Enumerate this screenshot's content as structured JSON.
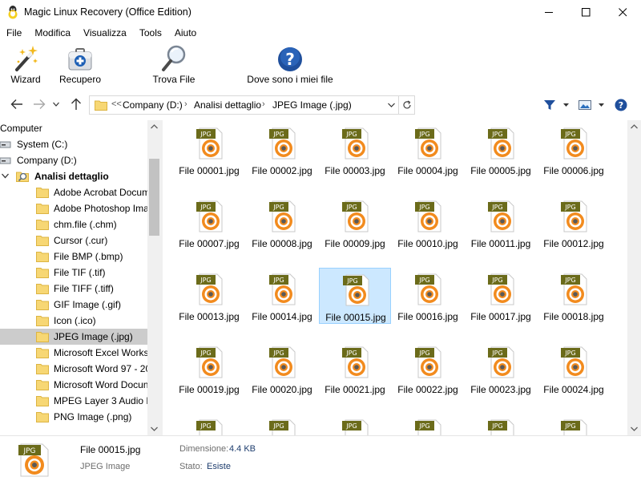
{
  "window": {
    "title": "Magic Linux Recovery (Office Edition)"
  },
  "menu": {
    "items": [
      "File",
      "Modifica",
      "Visualizza",
      "Tools",
      "Aiuto"
    ]
  },
  "toolbar": {
    "wizard_label": "Wizard",
    "recupero_label": "Recupero",
    "trova_label": "Trova File",
    "help_label": "Dove sono i miei file"
  },
  "address": {
    "prefix": "<<",
    "segments": [
      "Company (D:)",
      "Analisi dettaglio",
      "JPEG Image (.jpg)"
    ]
  },
  "tree": {
    "root": "Computer",
    "drives": [
      "System (C:)",
      "Company (D:)"
    ],
    "analysis": "Analisi dettaglio",
    "folders": [
      "Adobe Acrobat Docum",
      "Adobe Photoshop Ima",
      "chm.file (.chm)",
      "Cursor (.cur)",
      "File BMP (.bmp)",
      "File TIF (.tif)",
      "File TIFF (.tiff)",
      "GIF Image (.gif)",
      "Icon (.ico)",
      "JPEG Image (.jpg)",
      "Microsoft Excel Works",
      "Microsoft Word 97 - 20",
      "Microsoft Word Docun",
      "MPEG Layer 3 Audio F",
      "PNG Image (.png)"
    ],
    "selected_folder": "JPEG Image (.jpg)"
  },
  "files": {
    "badge": "JPG",
    "names": [
      "File 00001.jpg",
      "File 00002.jpg",
      "File 00003.jpg",
      "File 00004.jpg",
      "File 00005.jpg",
      "File 00006.jpg",
      "File 00007.jpg",
      "File 00008.jpg",
      "File 00009.jpg",
      "File 00010.jpg",
      "File 00011.jpg",
      "File 00012.jpg",
      "File 00013.jpg",
      "File 00014.jpg",
      "File 00015.jpg",
      "File 00016.jpg",
      "File 00017.jpg",
      "File 00018.jpg",
      "File 00019.jpg",
      "File 00020.jpg",
      "File 00021.jpg",
      "File 00022.jpg",
      "File 00023.jpg",
      "File 00024.jpg"
    ],
    "selected": "File 00015.jpg"
  },
  "status": {
    "badge": "JPG",
    "file_name": "File 00015.jpg",
    "file_type": "JPEG Image",
    "size_label": "Dimensione:",
    "size_value": "4.4 KB",
    "state_label": "Stato:",
    "state_value": "Esiste"
  },
  "colors": {
    "icon_orange": "#f28b1e",
    "icon_badge": "#6b6b1a",
    "selection": "#cce8ff",
    "tree_selection": "#cccccc",
    "help_blue": "#1f4f9c"
  }
}
